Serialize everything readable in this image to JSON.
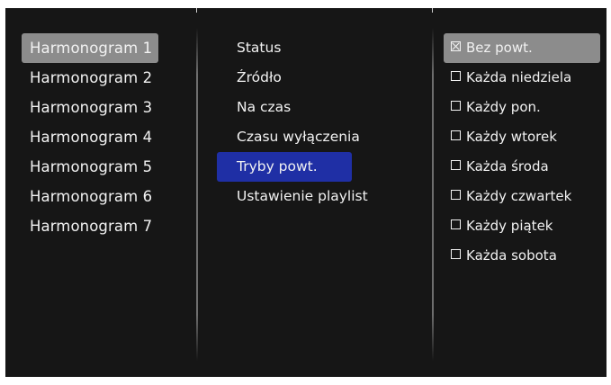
{
  "schedules": [
    {
      "label": "Harmonogram 1",
      "selected": true
    },
    {
      "label": "Harmonogram 2",
      "selected": false
    },
    {
      "label": "Harmonogram 3",
      "selected": false
    },
    {
      "label": "Harmonogram 4",
      "selected": false
    },
    {
      "label": "Harmonogram 5",
      "selected": false
    },
    {
      "label": "Harmonogram 6",
      "selected": false
    },
    {
      "label": "Harmonogram 7",
      "selected": false
    }
  ],
  "settings": [
    {
      "label": "Status",
      "selected": false
    },
    {
      "label": "Źródło",
      "selected": false
    },
    {
      "label": "Na czas",
      "selected": false
    },
    {
      "label": "Czasu wyłączenia",
      "selected": false
    },
    {
      "label": "Tryby powt.",
      "selected": true
    },
    {
      "label": "Ustawienie playlist",
      "selected": false
    }
  ],
  "repeat_modes": [
    {
      "label": "Bez powt.",
      "checked": true,
      "highlighted": true
    },
    {
      "label": "Każda niedziela",
      "checked": false,
      "highlighted": false
    },
    {
      "label": "Każdy pon.",
      "checked": false,
      "highlighted": false
    },
    {
      "label": "Każdy wtorek",
      "checked": false,
      "highlighted": false
    },
    {
      "label": "Każda środa",
      "checked": false,
      "highlighted": false
    },
    {
      "label": "Każdy czwartek",
      "checked": false,
      "highlighted": false
    },
    {
      "label": "Każdy piątek",
      "checked": false,
      "highlighted": false
    },
    {
      "label": "Każda sobota",
      "checked": false,
      "highlighted": false
    }
  ],
  "colors": {
    "panel_background": "#161616",
    "selection_gray": "#8c8c8c",
    "focus_blue": "#1f2fa5",
    "text": "#f2f2f2"
  }
}
